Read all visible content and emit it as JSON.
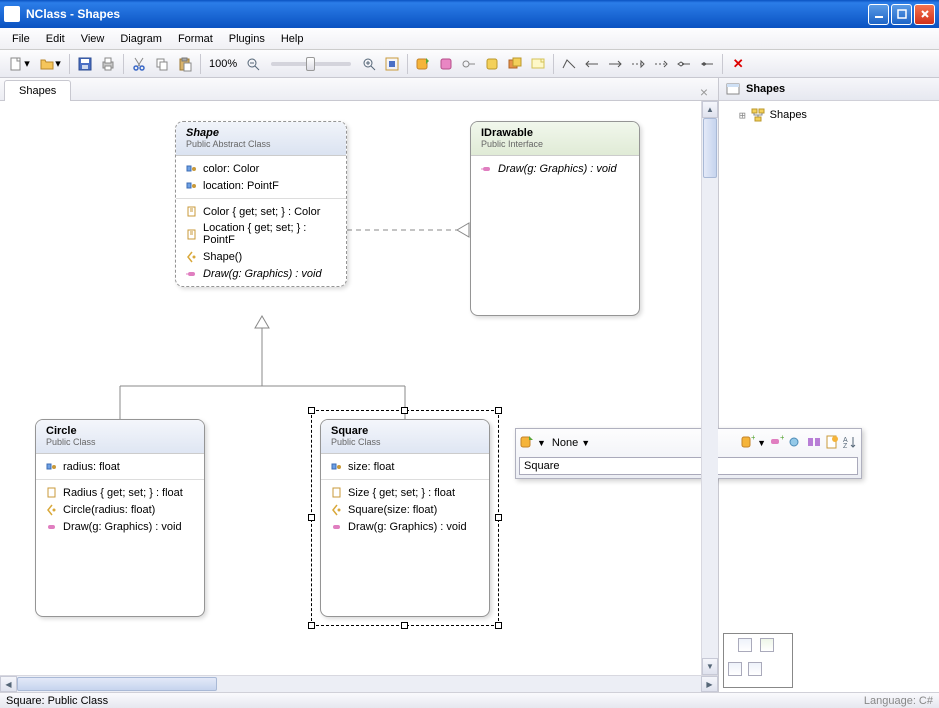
{
  "window": {
    "title": "NClass - Shapes"
  },
  "menu": [
    "File",
    "Edit",
    "View",
    "Diagram",
    "Format",
    "Plugins",
    "Help"
  ],
  "toolbar": {
    "zoom": "100%"
  },
  "tabs": {
    "active": "Shapes"
  },
  "uml": {
    "shape": {
      "name": "Shape",
      "stereotype": "Public Abstract Class",
      "fields": [
        "color: Color",
        "location: PointF"
      ],
      "members": [
        {
          "text": "Color { get; set; } : Color",
          "kind": "prop"
        },
        {
          "text": "Location { get; set; } : PointF",
          "kind": "prop"
        },
        {
          "text": "Shape()",
          "kind": "ctor"
        },
        {
          "text": "Draw(g: Graphics) : void",
          "kind": "method",
          "italic": true
        }
      ]
    },
    "idrawable": {
      "name": "IDrawable",
      "stereotype": "Public Interface",
      "members": [
        {
          "text": "Draw(g: Graphics) : void",
          "kind": "method",
          "italic": true
        }
      ]
    },
    "circle": {
      "name": "Circle",
      "stereotype": "Public Class",
      "fields": [
        "radius: float"
      ],
      "members": [
        {
          "text": "Radius { get; set; } : float",
          "kind": "prop"
        },
        {
          "text": "Circle(radius: float)",
          "kind": "ctor"
        },
        {
          "text": "Draw(g: Graphics) : void",
          "kind": "method"
        }
      ]
    },
    "square": {
      "name": "Square",
      "stereotype": "Public Class",
      "fields": [
        "size: float"
      ],
      "members": [
        {
          "text": "Size { get; set; } : float",
          "kind": "prop"
        },
        {
          "text": "Square(size: float)",
          "kind": "ctor"
        },
        {
          "text": "Draw(g: Graphics) : void",
          "kind": "method"
        }
      ]
    }
  },
  "float_editor": {
    "access": "None",
    "value": "Square"
  },
  "side": {
    "title": "Shapes",
    "item": "Shapes"
  },
  "status": {
    "left": "Square: Public Class",
    "lang": "Language: C#"
  }
}
